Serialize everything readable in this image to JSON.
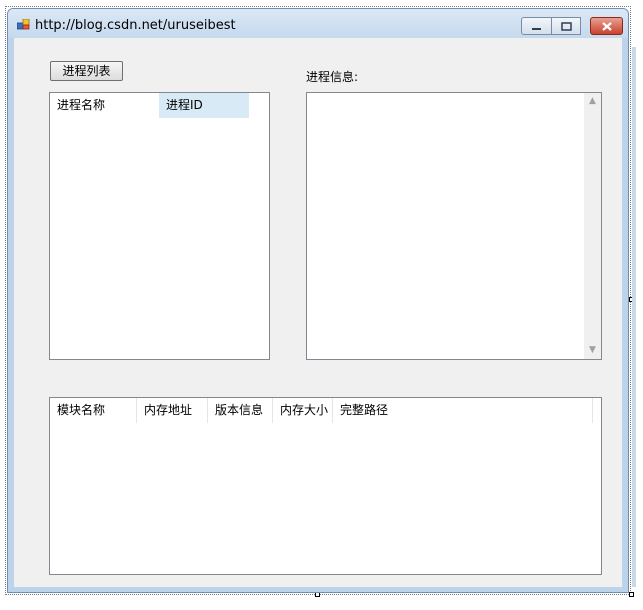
{
  "window": {
    "title": "http://blog.csdn.net/uruseibest"
  },
  "main": {
    "process_list_button": "进程列表",
    "process_info_label": "进程信息:",
    "process_list": {
      "columns": [
        "进程名称",
        "进程ID"
      ]
    },
    "process_info_text": "",
    "module_list": {
      "columns": [
        "模块名称",
        "内存地址",
        "版本信息",
        "内存大小",
        "完整路径"
      ]
    }
  }
}
